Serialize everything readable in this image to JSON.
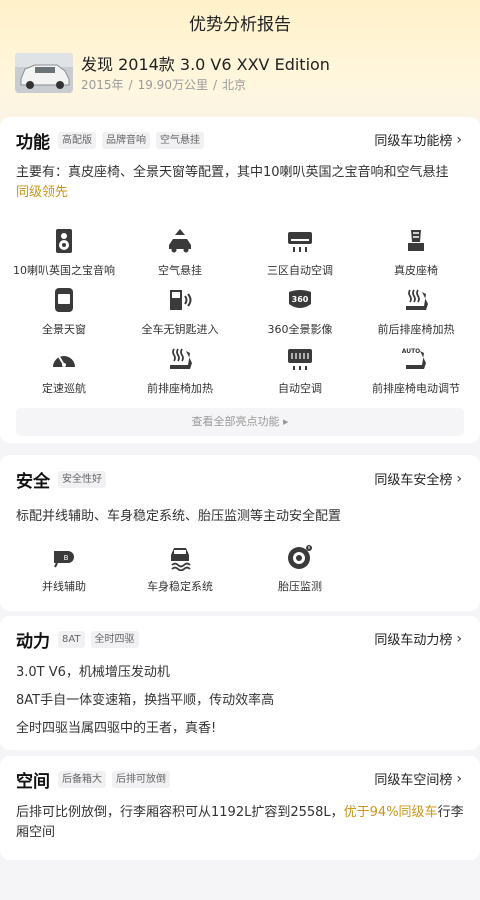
{
  "header": {
    "title": "优势分析报告"
  },
  "car": {
    "name": "发现 2014款 3.0 V6 XXV Edition",
    "year": "2015年",
    "mileage": "19.90万公里",
    "city": "北京",
    "separator": "/"
  },
  "features": {
    "title": "功能",
    "tags": [
      "高配版",
      "品牌音响",
      "空气悬挂"
    ],
    "rank_link": "同级车功能榜",
    "desc": "主要有：真皮座椅、全景天窗等配置，其中10喇叭英国之宝音响和空气悬挂",
    "highlight": "同级领先",
    "items": [
      {
        "label": "10喇叭英国之宝音响",
        "icon": "speaker-icon"
      },
      {
        "label": "空气悬挂",
        "icon": "air-suspension-icon"
      },
      {
        "label": "三区自动空调",
        "icon": "air-conditioner-icon"
      },
      {
        "label": "真皮座椅",
        "icon": "leather-seat-icon"
      },
      {
        "label": "全景天窗",
        "icon": "sunroof-icon"
      },
      {
        "label": "全车无钥匙进入",
        "icon": "keyless-entry-icon"
      },
      {
        "label": "360全景影像",
        "icon": "camera-360-icon"
      },
      {
        "label": "前后排座椅加热",
        "icon": "seat-heat-icon"
      },
      {
        "label": "定速巡航",
        "icon": "cruise-control-icon"
      },
      {
        "label": "前排座椅加热",
        "icon": "front-seat-heat-icon"
      },
      {
        "label": "自动空调",
        "icon": "auto-ac-icon"
      },
      {
        "label": "前排座椅电动调节",
        "icon": "electric-seat-icon"
      }
    ],
    "view_all": "查看全部亮点功能 ▸"
  },
  "safety": {
    "title": "安全",
    "tags": [
      "安全性好"
    ],
    "rank_link": "同级车安全榜",
    "desc": "标配并线辅助、车身稳定系统、胎压监测等主动安全配置",
    "items": [
      {
        "label": "并线辅助",
        "icon": "lane-assist-icon"
      },
      {
        "label": "车身稳定系统",
        "icon": "stability-icon"
      },
      {
        "label": "胎压监测",
        "icon": "tire-pressure-icon"
      }
    ]
  },
  "power": {
    "title": "动力",
    "tags": [
      "8AT",
      "全时四驱"
    ],
    "rank_link": "同级车动力榜",
    "lines": [
      "3.0T V6，机械增压发动机",
      "8AT手自一体变速箱，换挡平顺，传动效率高",
      "全时四驱当属四驱中的王者，真香!"
    ]
  },
  "space": {
    "title": "空间",
    "tags": [
      "后备箱大",
      "后排可放倒"
    ],
    "rank_link": "同级车空间榜",
    "desc_prefix": "后排可比例放倒，行李厢容积可从1192L扩容到2558L，",
    "highlight": "优于94%同级车",
    "desc_suffix": "行李厢空间"
  },
  "colors": {
    "accent_gold": "#c8971a",
    "hero_bg": "#fff1c9"
  }
}
